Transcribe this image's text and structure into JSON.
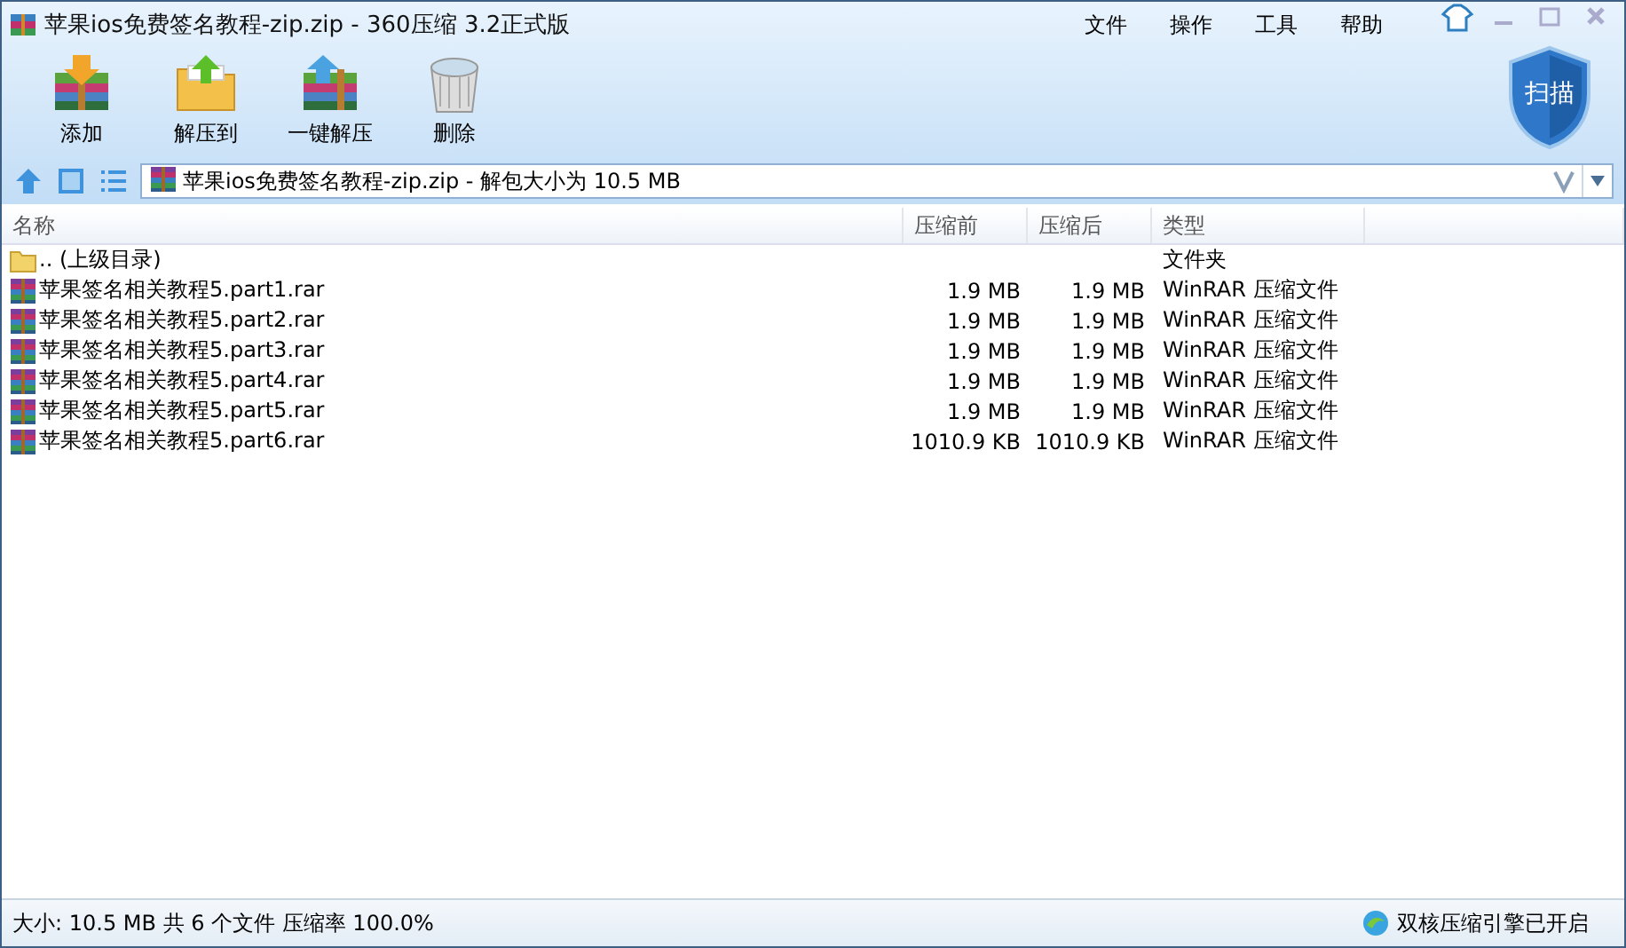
{
  "window": {
    "title": "苹果ios免费签名教程-zip.zip - 360压缩 3.2正式版"
  },
  "menu": [
    "文件",
    "操作",
    "工具",
    "帮助"
  ],
  "toolbar": [
    {
      "label": "添加",
      "kind": "add"
    },
    {
      "label": "解压到",
      "kind": "extract-to"
    },
    {
      "label": "一键解压",
      "kind": "one-click"
    },
    {
      "label": "删除",
      "kind": "delete"
    }
  ],
  "scan_button": "扫描",
  "address": "苹果ios免费签名教程-zip.zip - 解包大小为 10.5 MB",
  "table": {
    "columns": [
      "名称",
      "压缩前",
      "压缩后",
      "类型"
    ],
    "rows": [
      {
        "kind": "folder",
        "name": ".. (上级目录)",
        "before": "",
        "after": "",
        "type": "文件夹"
      },
      {
        "kind": "archive",
        "name": "苹果签名相关教程5.part1.rar",
        "before": "1.9 MB",
        "after": "1.9 MB",
        "type": "WinRAR 压缩文件"
      },
      {
        "kind": "archive",
        "name": "苹果签名相关教程5.part2.rar",
        "before": "1.9 MB",
        "after": "1.9 MB",
        "type": "WinRAR 压缩文件"
      },
      {
        "kind": "archive",
        "name": "苹果签名相关教程5.part3.rar",
        "before": "1.9 MB",
        "after": "1.9 MB",
        "type": "WinRAR 压缩文件"
      },
      {
        "kind": "archive",
        "name": "苹果签名相关教程5.part4.rar",
        "before": "1.9 MB",
        "after": "1.9 MB",
        "type": "WinRAR 压缩文件"
      },
      {
        "kind": "archive",
        "name": "苹果签名相关教程5.part5.rar",
        "before": "1.9 MB",
        "after": "1.9 MB",
        "type": "WinRAR 压缩文件"
      },
      {
        "kind": "archive",
        "name": "苹果签名相关教程5.part6.rar",
        "before": "1010.9 KB",
        "after": "1010.9 KB",
        "type": "WinRAR 压缩文件"
      }
    ]
  },
  "status_bar": {
    "summary": "大小: 10.5 MB 共 6 个文件 压缩率 100.0%",
    "engine": "双核压缩引擎已开启"
  }
}
